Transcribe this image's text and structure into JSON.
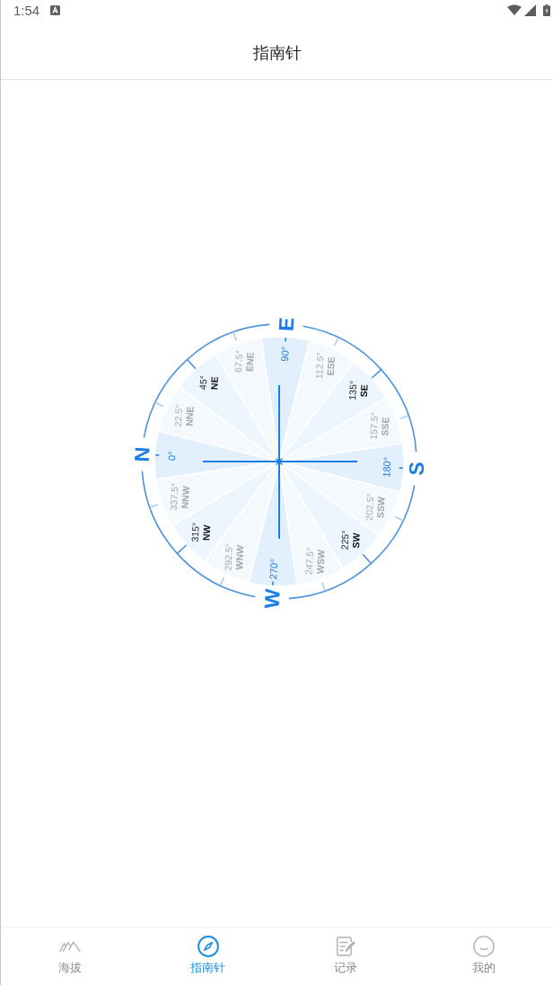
{
  "status_bar": {
    "time": "1:54"
  },
  "header": {
    "title": "指南针"
  },
  "compass": {
    "directions": [
      {
        "kind": "cardinal",
        "degree": "0°",
        "letter": "N"
      },
      {
        "kind": "minor",
        "degree": "22.5°",
        "abbr": "NNE"
      },
      {
        "kind": "intercardinal",
        "degree": "45°",
        "abbr": "NE"
      },
      {
        "kind": "minor",
        "degree": "67.5°",
        "abbr": "ENE"
      },
      {
        "kind": "cardinal",
        "degree": "90°",
        "letter": "E"
      },
      {
        "kind": "minor",
        "degree": "112.5°",
        "abbr": "ESE"
      },
      {
        "kind": "intercardinal",
        "degree": "135°",
        "abbr": "SE"
      },
      {
        "kind": "minor",
        "degree": "157.5°",
        "abbr": "SSE"
      },
      {
        "kind": "cardinal",
        "degree": "180°",
        "letter": "S"
      },
      {
        "kind": "minor",
        "degree": "202.5°",
        "abbr": "SSW"
      },
      {
        "kind": "intercardinal",
        "degree": "225°",
        "abbr": "SW"
      },
      {
        "kind": "minor",
        "degree": "247.5°",
        "abbr": "WSW"
      },
      {
        "kind": "cardinal",
        "degree": "270°",
        "letter": "W"
      },
      {
        "kind": "minor",
        "degree": "292.5°",
        "abbr": "WNW"
      },
      {
        "kind": "intercardinal",
        "degree": "315°",
        "abbr": "NW"
      },
      {
        "kind": "minor",
        "degree": "337.5°",
        "abbr": "NNW"
      }
    ]
  },
  "tabs": [
    {
      "label": "海拔",
      "selected": false
    },
    {
      "label": "指南针",
      "selected": true
    },
    {
      "label": "记录",
      "selected": false
    },
    {
      "label": "我的",
      "selected": false
    }
  ]
}
